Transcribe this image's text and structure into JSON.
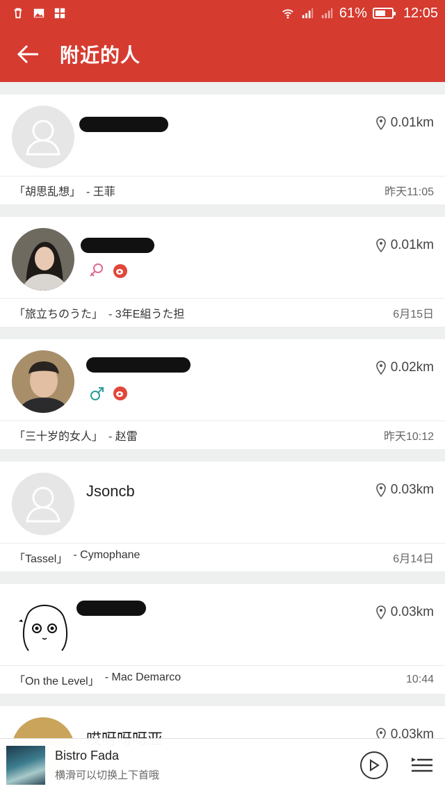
{
  "statusbar": {
    "battery": "61%",
    "clock": "12:05"
  },
  "appbar": {
    "title": "附近的人"
  },
  "people": [
    {
      "name": "",
      "distance": "0.01km",
      "song": "「胡思乱想」",
      "artist": "- 王菲",
      "time": "昨天11:05",
      "gender": "",
      "weibo": false,
      "avatar": "placeholder"
    },
    {
      "name": "",
      "distance": "0.01km",
      "song": "「旅立ちのうた」",
      "artist": "- 3年E組うた担",
      "time": "6月15日",
      "gender": "female",
      "weibo": true,
      "avatar": "photo-woman"
    },
    {
      "name": "",
      "distance": "0.02km",
      "song": "「三十岁的女人」",
      "artist": "- 赵雷",
      "time": "昨天10:12",
      "gender": "male",
      "weibo": true,
      "avatar": "photo-man"
    },
    {
      "name": "Jsoncb",
      "distance": "0.03km",
      "song": "「Tassel」",
      "artist": "- Cymophane",
      "time": "6月14日",
      "gender": "",
      "weibo": false,
      "avatar": "placeholder"
    },
    {
      "name": "",
      "distance": "0.03km",
      "song": "「On the Level」",
      "artist": "- Mac Demarco",
      "time": "10:44",
      "gender": "",
      "weibo": false,
      "avatar": "drawing"
    },
    {
      "name": "哎呀呀呀亚",
      "distance": "0.03km",
      "song": "",
      "artist": "",
      "time": "",
      "gender": "",
      "weibo": false,
      "avatar": "photo-cut"
    }
  ],
  "player": {
    "title": "Bistro Fada",
    "subtitle": "横滑可以切换上下首哦"
  },
  "colors": {
    "accent": "#d63b30",
    "female": "#e06b8f",
    "male": "#2a9d9a",
    "weibo": "#e0473a"
  }
}
